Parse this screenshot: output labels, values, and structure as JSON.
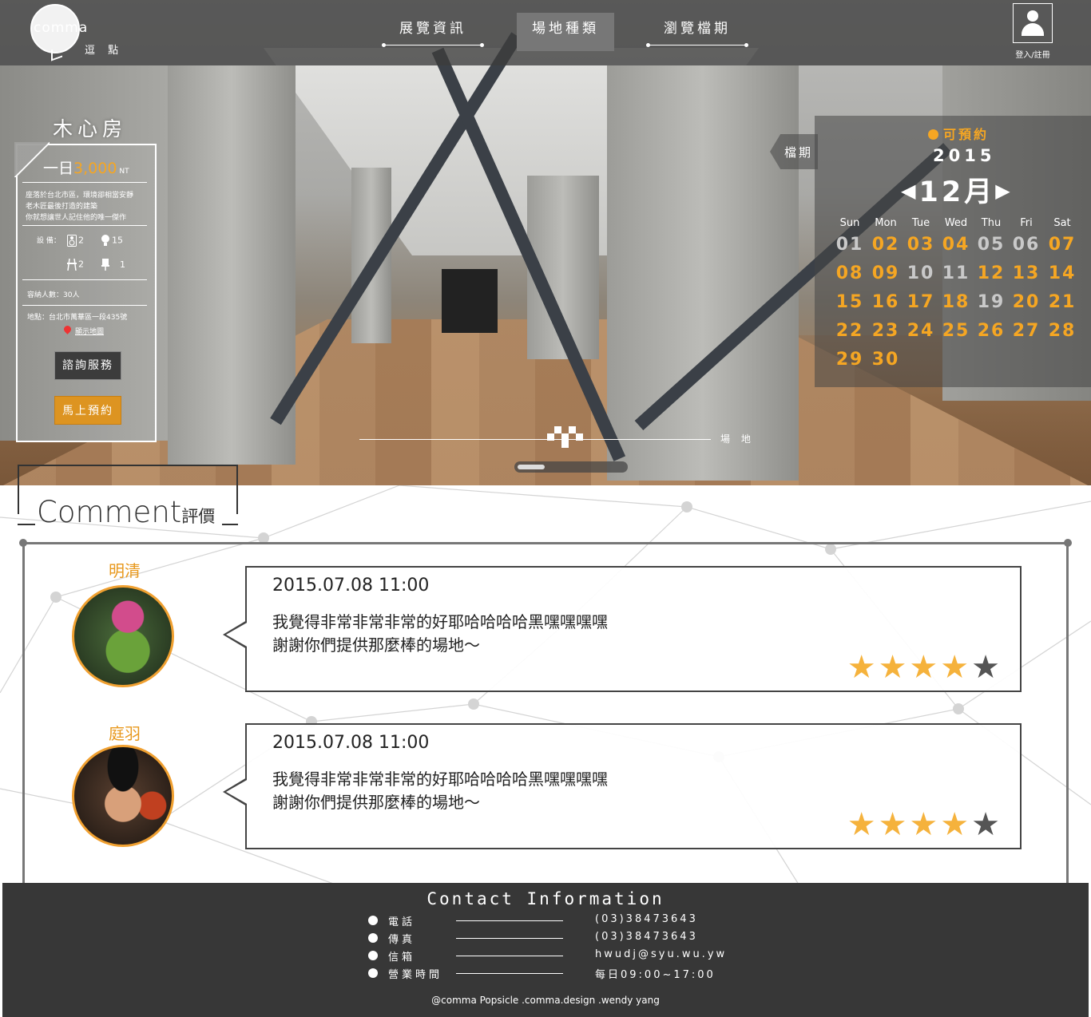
{
  "brand": {
    "logo_text": "comma",
    "logo_sub": "逗 點"
  },
  "nav": {
    "items": [
      {
        "label": "展覽資訊",
        "active": false
      },
      {
        "label": "場地種類",
        "active": true
      },
      {
        "label": "瀏覽檔期",
        "active": false
      }
    ],
    "login_label": "登入/註冊"
  },
  "venue": {
    "name": "木心房",
    "price_prefix": "一日",
    "price_amount": "3,000",
    "price_unit": "NT",
    "description": "座落於台北市區，環境卻相當安靜\n老木匠最後打造的建築\n你就想讓世人記住他的唯一傑作",
    "equipment_label": "設 備：",
    "equipment": [
      {
        "icon": "speaker-icon",
        "count": "2"
      },
      {
        "icon": "lightbulb-icon",
        "count": "15"
      },
      {
        "icon": "table-icon",
        "count": "2"
      },
      {
        "icon": "chair-icon",
        "count": "1"
      }
    ],
    "capacity": "容納人數：30人",
    "address": "地點：台北市萬華區一段435號",
    "map_link": "顯示地圖",
    "consult_button": "諮詢服務",
    "book_button": "馬上預約"
  },
  "slider": {
    "label": "場 地"
  },
  "calendar": {
    "tab_label": "檔期",
    "available_label": "可預約",
    "year": "2015",
    "month": "12月",
    "prev_icon": "◀",
    "next_icon": "▶",
    "weekdays": [
      "Sun",
      "Mon",
      "Tue",
      "Wed",
      "Thu",
      "Fri",
      "Sat"
    ],
    "days": [
      {
        "d": "01",
        "available": false
      },
      {
        "d": "02",
        "available": true
      },
      {
        "d": "03",
        "available": true
      },
      {
        "d": "04",
        "available": true
      },
      {
        "d": "05",
        "available": false
      },
      {
        "d": "06",
        "available": false
      },
      {
        "d": "07",
        "available": true
      },
      {
        "d": "08",
        "available": true
      },
      {
        "d": "09",
        "available": true
      },
      {
        "d": "10",
        "available": false
      },
      {
        "d": "11",
        "available": false
      },
      {
        "d": "12",
        "available": true
      },
      {
        "d": "13",
        "available": true
      },
      {
        "d": "14",
        "available": true
      },
      {
        "d": "15",
        "available": true
      },
      {
        "d": "16",
        "available": true
      },
      {
        "d": "17",
        "available": true
      },
      {
        "d": "18",
        "available": true
      },
      {
        "d": "19",
        "available": false
      },
      {
        "d": "20",
        "available": true
      },
      {
        "d": "21",
        "available": true
      },
      {
        "d": "22",
        "available": true
      },
      {
        "d": "23",
        "available": true
      },
      {
        "d": "24",
        "available": true
      },
      {
        "d": "25",
        "available": true
      },
      {
        "d": "26",
        "available": true
      },
      {
        "d": "27",
        "available": true
      },
      {
        "d": "28",
        "available": true
      },
      {
        "d": "29",
        "available": true
      },
      {
        "d": "30",
        "available": true
      }
    ],
    "colors": {
      "available": "#f5a623",
      "unavailable": "#c9c9c9"
    }
  },
  "comments": {
    "title_en": "Comment",
    "title_zh": "評價",
    "reviews": [
      {
        "name": "明清",
        "datetime": "2015.07.08   11:00",
        "text_line1": "我覺得非常非常非常的好耶哈哈哈哈黑嘿嘿嘿嘿",
        "text_line2": "謝謝你們提供那麼棒的場地～",
        "rating": 4,
        "max_rating": 5
      },
      {
        "name": "庭羽",
        "datetime": "2015.07.08   11:00",
        "text_line1": "我覺得非常非常非常的好耶哈哈哈哈黑嘿嘿嘿嘿",
        "text_line2": "謝謝你們提供那麼棒的場地～",
        "rating": 4,
        "max_rating": 5
      }
    ]
  },
  "footer": {
    "title": "Contact Information",
    "rows": [
      {
        "label": "電話",
        "value": "(03)38473643"
      },
      {
        "label": "傳真",
        "value": "(03)38473643"
      },
      {
        "label": "信箱",
        "value": "hwudj@syu.wu.yw"
      },
      {
        "label": "營業時間",
        "value": "每日09:00~17:00"
      }
    ],
    "copyright": "@comma Popsicle .comma.design .wendy yang"
  },
  "colors": {
    "accent": "#f5a623",
    "footer_bg": "#373737",
    "topbar_bg": "#3c3c3c"
  }
}
